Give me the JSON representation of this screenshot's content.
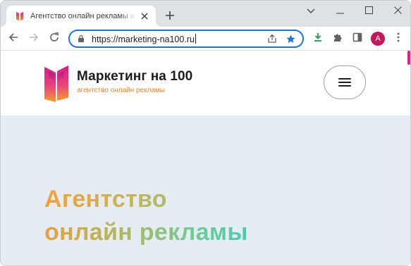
{
  "browser": {
    "tab": {
      "title": "Агентство онлайн рекламы и разработки",
      "favicon": "marketing-logo-favicon"
    },
    "new_tab_icon": "plus-icon",
    "window_controls": [
      "chevron-down-icon",
      "minimize-icon",
      "maximize-icon",
      "close-icon"
    ],
    "nav": [
      "back-arrow-icon",
      "forward-arrow-icon",
      "reload-icon"
    ],
    "url": "https://marketing-na100.ru",
    "omnibox_icons": [
      "share-icon",
      "bookmark-star-icon"
    ],
    "extensions": [
      "download-extension-icon",
      "puzzle-icon",
      "side-panel-icon"
    ],
    "profile_initial": "A",
    "menu_icon": "three-dots-icon",
    "colors": {
      "focus_ring": "#1a73e8",
      "star": "#1a73e8",
      "avatar": "#c2185b",
      "download_ext": "#34a853"
    }
  },
  "site": {
    "brand_name": "Маркетинг на 100",
    "brand_tagline": "агентство онлайн рекламы",
    "menu_button_icon": "hamburger-icon",
    "hero": {
      "title_line1": "Агентство",
      "title_line2": "онлайн рекламы"
    },
    "colors": {
      "tagline": "#f07d1c",
      "hero_bg": "#e6ecf4",
      "gradient_start": "#f2a23a",
      "gradient_end": "#4fc8b0",
      "accent_magenta": "#e0218a"
    }
  }
}
